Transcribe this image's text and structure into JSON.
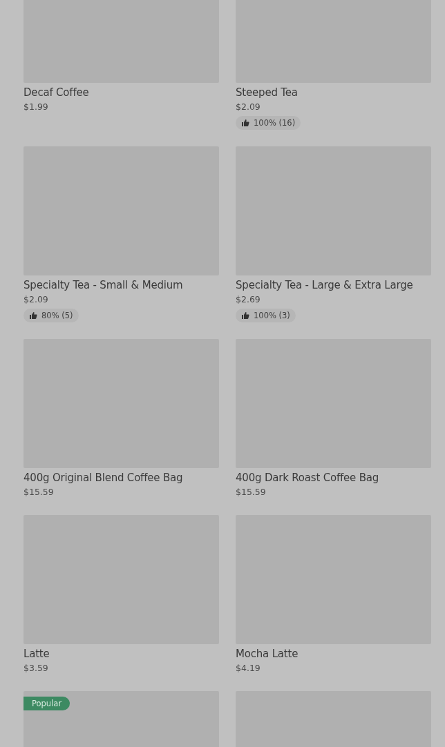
{
  "products": [
    {
      "kind": "product",
      "name": "Decaf Coffee",
      "price": "$1.99"
    },
    {
      "kind": "product",
      "name": "Steeped Tea",
      "price": "$2.09",
      "rating": "100% (16)"
    },
    {
      "kind": "product",
      "name": "Specialty Tea - Small & Medium",
      "price": "$2.09",
      "rating": "80% (5)"
    },
    {
      "kind": "product",
      "name": "Specialty Tea - Large & Extra Large",
      "price": "$2.69",
      "rating": "100% (3)"
    },
    {
      "kind": "product",
      "name": "400g Original Blend Coffee Bag",
      "price": "$15.59"
    },
    {
      "kind": "product",
      "name": "400g Dark Roast Coffee Bag",
      "price": "$15.59"
    },
    {
      "kind": "product",
      "name": "Latte",
      "price": "$3.59"
    },
    {
      "kind": "product",
      "name": "Mocha Latte",
      "price": "$4.19"
    },
    {
      "kind": "product",
      "badge": "Popular"
    },
    {
      "kind": "product"
    }
  ]
}
